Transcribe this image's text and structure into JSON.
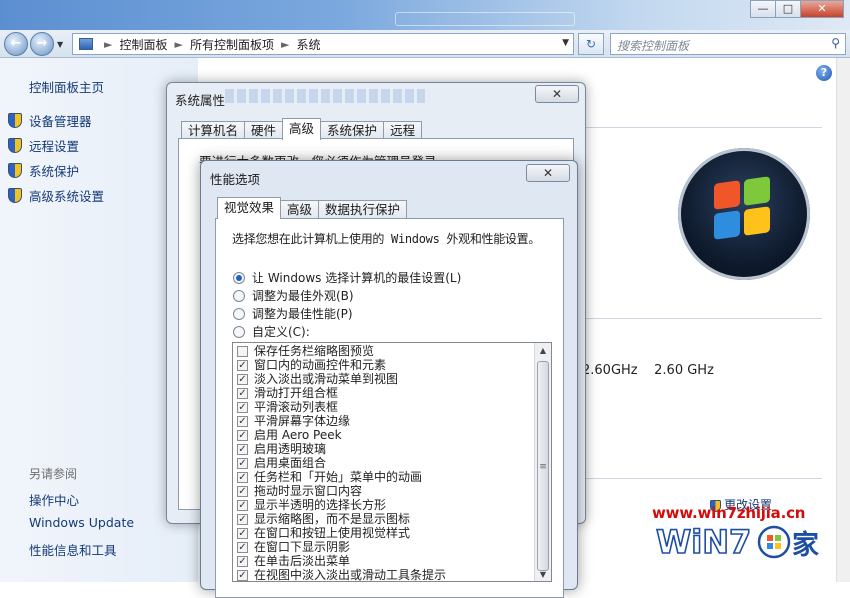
{
  "window": {
    "min_glyph": "—",
    "max_glyph": "□",
    "close_glyph": "✕"
  },
  "address_bar": {
    "back_glyph": "←",
    "forward_glyph": "→",
    "breadcrumb": [
      "控制面板",
      "所有控制面板项",
      "系统"
    ],
    "search_placeholder": "搜索控制面板"
  },
  "left_nav": {
    "home": "控制面板主页",
    "tasks": [
      "设备管理器",
      "远程设置",
      "系统保护",
      "高级系统设置"
    ],
    "see_also_title": "另请参阅",
    "see_also": [
      "操作中心",
      "Windows Update",
      "性能信息和工具"
    ]
  },
  "main": {
    "cpu_speed_1": "2.60GHz",
    "cpu_speed_2": "2.60 GHz",
    "change_settings": "更改设置"
  },
  "system_properties": {
    "title": "系统属性",
    "tabs": [
      "计算机名",
      "硬件",
      "高级",
      "系统保护",
      "远程"
    ],
    "active_tab": "高级",
    "notice": "要进行大多数更改，您必须作为管理员登录。"
  },
  "performance_options": {
    "title": "性能选项",
    "tabs": [
      "视觉效果",
      "高级",
      "数据执行保护"
    ],
    "active_tab": "视觉效果",
    "description": "选择您想在此计算机上使用的 Windows 外观和性能设置。",
    "radios": [
      {
        "label": "让 Windows 选择计算机的最佳设置(L)",
        "selected": true
      },
      {
        "label": "调整为最佳外观(B)",
        "selected": false
      },
      {
        "label": "调整为最佳性能(P)",
        "selected": false
      },
      {
        "label": "自定义(C):",
        "selected": false
      }
    ],
    "options": [
      {
        "label": "保存任务栏缩略图预览",
        "checked": false
      },
      {
        "label": "窗口内的动画控件和元素",
        "checked": true
      },
      {
        "label": "淡入淡出或滑动菜单到视图",
        "checked": true
      },
      {
        "label": "滑动打开组合框",
        "checked": true
      },
      {
        "label": "平滑滚动列表框",
        "checked": true
      },
      {
        "label": "平滑屏幕字体边缘",
        "checked": true
      },
      {
        "label": "启用 Aero Peek",
        "checked": true
      },
      {
        "label": "启用透明玻璃",
        "checked": true
      },
      {
        "label": "启用桌面组合",
        "checked": true
      },
      {
        "label": "任务栏和「开始」菜单中的动画",
        "checked": true
      },
      {
        "label": "拖动时显示窗口内容",
        "checked": true
      },
      {
        "label": "显示半透明的选择长方形",
        "checked": true
      },
      {
        "label": "显示缩略图，而不是显示图标",
        "checked": true
      },
      {
        "label": "在窗口和按钮上使用视觉样式",
        "checked": true
      },
      {
        "label": "在窗口下显示阴影",
        "checked": true
      },
      {
        "label": "在单击后淡出菜单",
        "checked": true
      },
      {
        "label": "在视图中淡入淡出或滑动工具条提示",
        "checked": true
      }
    ]
  },
  "watermark": {
    "url": "www.win7zhijia.cn",
    "logo_text": "WiN7",
    "logo_suffix": "家"
  }
}
